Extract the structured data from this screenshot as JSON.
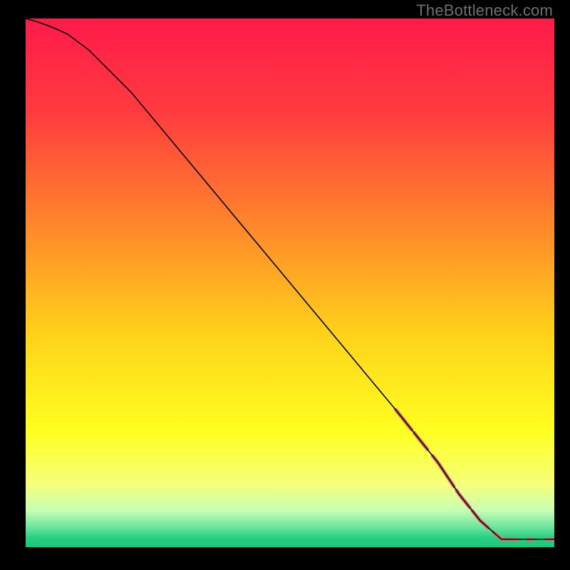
{
  "watermark": {
    "text": "TheBottleneck.com"
  },
  "chart_data": {
    "type": "line",
    "title": "",
    "xlabel": "",
    "ylabel": "",
    "xlim": [
      0,
      100
    ],
    "ylim": [
      0,
      100
    ],
    "grid": false,
    "legend": false,
    "curve": {
      "name": "bottleneck-curve",
      "x": [
        0,
        4,
        8,
        12,
        20,
        30,
        40,
        50,
        60,
        70,
        78,
        82,
        86,
        90,
        94,
        98,
        100
      ],
      "y": [
        100,
        99,
        97,
        94,
        86,
        74,
        62,
        50,
        38,
        26,
        16,
        10,
        5,
        1.5,
        1.5,
        1.5,
        1.5
      ]
    },
    "highlight_segments": [
      {
        "x0": 70,
        "x1": 73,
        "thickness": 5
      },
      {
        "x0": 73.5,
        "x1": 76,
        "thickness": 5
      },
      {
        "x0": 77,
        "x1": 81,
        "thickness": 5
      },
      {
        "x0": 81.5,
        "x1": 84,
        "thickness": 5
      },
      {
        "x0": 84.5,
        "x1": 87.5,
        "thickness": 5
      },
      {
        "x0": 88.5,
        "x1": 91.5,
        "thickness": 5
      },
      {
        "x0": 92,
        "x1": 93,
        "thickness": 5
      },
      {
        "x0": 95,
        "x1": 96,
        "thickness": 5
      },
      {
        "x0": 98.5,
        "x1": 100,
        "thickness": 5
      }
    ],
    "gradient_stops": [
      {
        "pct": 0,
        "color": "#ff1a4a"
      },
      {
        "pct": 18,
        "color": "#ff3c3e"
      },
      {
        "pct": 40,
        "color": "#ff8a2a"
      },
      {
        "pct": 60,
        "color": "#ffd31a"
      },
      {
        "pct": 78,
        "color": "#ffff20"
      },
      {
        "pct": 88,
        "color": "#f6ff7a"
      },
      {
        "pct": 93,
        "color": "#c8ffb4"
      },
      {
        "pct": 96.5,
        "color": "#63e29a"
      },
      {
        "pct": 98.2,
        "color": "#28cf84"
      },
      {
        "pct": 100,
        "color": "#18c878"
      }
    ],
    "highlight_color": "#e06a6a",
    "curve_color": "#000000"
  }
}
